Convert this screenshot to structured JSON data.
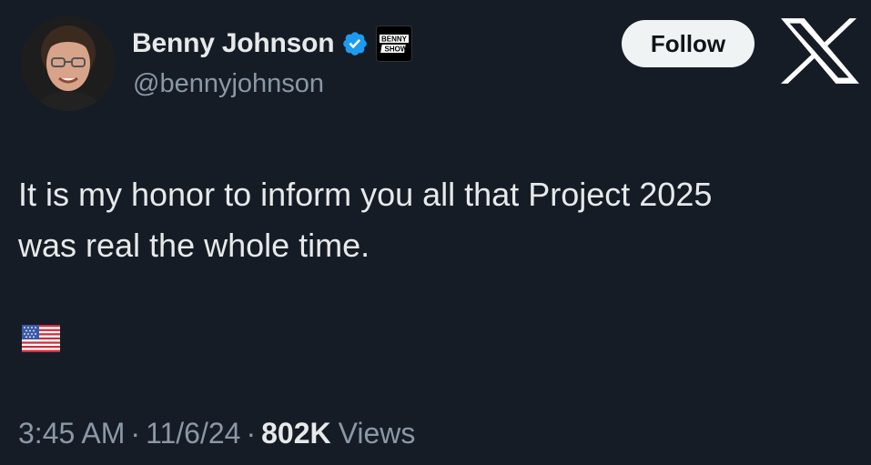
{
  "author": {
    "display_name": "Benny Johnson",
    "handle": "@bennyjohnson",
    "affiliate_badge_text": [
      "BENNY",
      "SHOW"
    ]
  },
  "actions": {
    "follow_label": "Follow"
  },
  "icons": {
    "verified": "verified-badge-icon",
    "brand": "x-logo-icon",
    "flag": "us-flag-emoji"
  },
  "tweet": {
    "lines": [
      "It is my honor to inform you all that Project 2025",
      "was real the whole time."
    ]
  },
  "meta": {
    "time": "3:45 AM",
    "separator": "·",
    "date": "11/6/24",
    "views_count": "802K",
    "views_label": "Views"
  },
  "colors": {
    "background": "#151c26",
    "text_primary": "#e7e9ea",
    "text_secondary": "#8b98a5",
    "verified_blue": "#1d9bf0",
    "follow_bg": "#eff3f4"
  }
}
